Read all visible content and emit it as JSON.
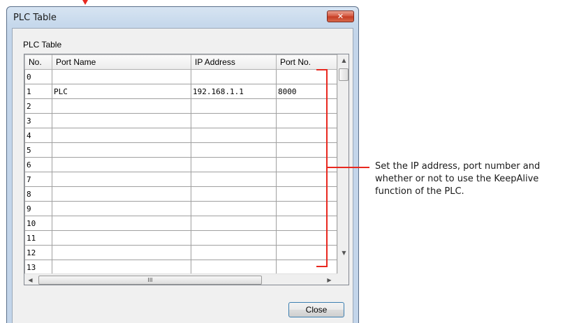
{
  "window": {
    "title": "PLC Table",
    "close_glyph": "✕"
  },
  "group": {
    "label": "PLC Table"
  },
  "table": {
    "columns": [
      "No.",
      "Port Name",
      "IP Address",
      "Port No."
    ],
    "rows": [
      [
        "0",
        "",
        "",
        ""
      ],
      [
        "1",
        "PLC",
        "192.168.1.1",
        "8000"
      ],
      [
        "2",
        "",
        "",
        ""
      ],
      [
        "3",
        "",
        "",
        ""
      ],
      [
        "4",
        "",
        "",
        ""
      ],
      [
        "5",
        "",
        "",
        ""
      ],
      [
        "6",
        "",
        "",
        ""
      ],
      [
        "7",
        "",
        "",
        ""
      ],
      [
        "8",
        "",
        "",
        ""
      ],
      [
        "9",
        "",
        "",
        ""
      ],
      [
        "10",
        "",
        "",
        ""
      ],
      [
        "11",
        "",
        "",
        ""
      ],
      [
        "12",
        "",
        "",
        ""
      ],
      [
        "13",
        "",
        "",
        ""
      ]
    ]
  },
  "scrollbars": {
    "up_glyph": "▲",
    "down_glyph": "▼",
    "left_glyph": "◀",
    "right_glyph": "▶",
    "thumb_grip": "III"
  },
  "buttons": {
    "close": "Close"
  },
  "annotation": {
    "text": "Set the IP address, port number and whether or not to use the KeepAlive function of the PLC."
  },
  "colors": {
    "annotation_accent": "#e8281f",
    "close_button_red": "#c43a22"
  }
}
